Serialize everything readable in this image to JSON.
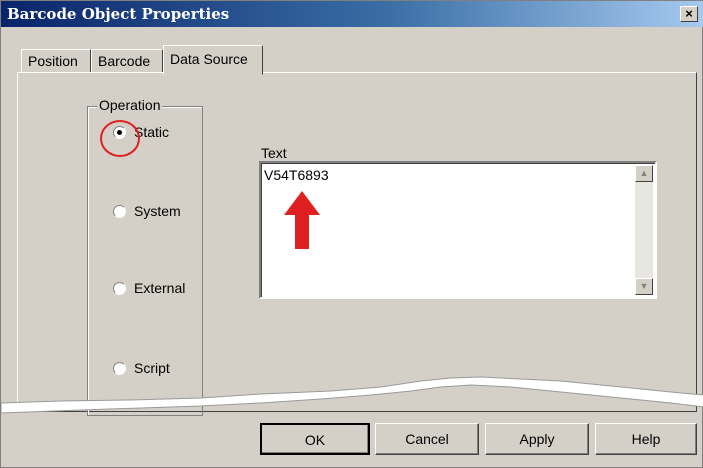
{
  "window": {
    "title": "Barcode Object Properties",
    "close_label": "×"
  },
  "tabs": [
    {
      "label": "Position",
      "active": false
    },
    {
      "label": "Barcode",
      "active": false
    },
    {
      "label": "Data Source",
      "active": true
    }
  ],
  "operation": {
    "legend": "Operation",
    "options": [
      {
        "label": "Static",
        "checked": true
      },
      {
        "label": "System",
        "checked": false
      },
      {
        "label": "External",
        "checked": false
      },
      {
        "label": "Script",
        "checked": false
      }
    ]
  },
  "text_field": {
    "label": "Text",
    "value": "V54T6893"
  },
  "buttons": {
    "ok": "OK",
    "cancel": "Cancel",
    "apply": "Apply",
    "help": "Help"
  },
  "annotation": {
    "color": "#e02020"
  }
}
